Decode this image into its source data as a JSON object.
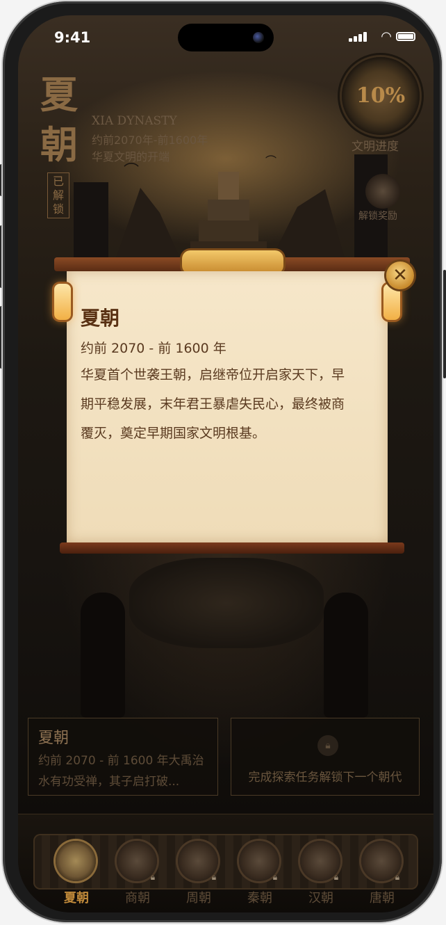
{
  "status": {
    "time": "9:41"
  },
  "header": {
    "title_char1": "夏",
    "title_char2": "朝",
    "unlocked_badge": "已解锁",
    "english_name": "XIA DYNASTY",
    "subtitle_line1": "约前2070年-前1600年",
    "subtitle_line2": "华夏文明的开端"
  },
  "progress": {
    "value": "10%",
    "label": "文明进度"
  },
  "reward": {
    "label": "解锁奖励"
  },
  "modal": {
    "title": "夏朝",
    "date": "约前 2070 - 前 1600 年",
    "description": "华夏首个世袭王朝，启继帝位开启家天下，早期平稳发展，末年君王暴虐失民心，最终被商覆灭，奠定早期国家文明根基。",
    "close": "✕"
  },
  "cards": {
    "current": {
      "title": "夏朝",
      "desc": "约前 2070 - 前 1600 年大禹治水有功受禅，其子启打破..."
    },
    "locked": {
      "lock_icon": "lock-icon",
      "text": "完成探索任务解锁下一个朝代"
    }
  },
  "nav": {
    "items": [
      {
        "label": "夏朝",
        "active": true,
        "locked": false
      },
      {
        "label": "商朝",
        "active": false,
        "locked": true
      },
      {
        "label": "周朝",
        "active": false,
        "locked": true
      },
      {
        "label": "秦朝",
        "active": false,
        "locked": true
      },
      {
        "label": "汉朝",
        "active": false,
        "locked": true
      },
      {
        "label": "唐朝",
        "active": false,
        "locked": true
      }
    ]
  },
  "colors": {
    "accent": "#c08a3a",
    "paper": "#f3e2c3",
    "frame": "#7a3a1c"
  }
}
